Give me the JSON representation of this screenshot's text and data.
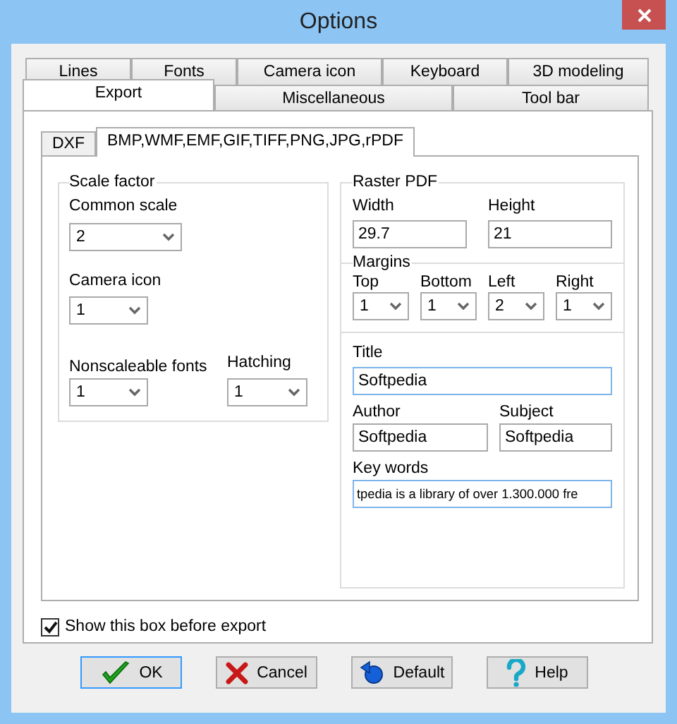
{
  "window": {
    "title": "Options"
  },
  "tab_rows": [
    [
      {
        "label": "Lines",
        "selected": false
      },
      {
        "label": "Fonts",
        "selected": false
      },
      {
        "label": "Camera icon",
        "selected": false
      },
      {
        "label": "Keyboard",
        "selected": false
      },
      {
        "label": "3D modeling",
        "selected": false
      }
    ],
    [
      {
        "label": "Export",
        "selected": true
      },
      {
        "label": "Miscellaneous",
        "selected": false
      },
      {
        "label": "Tool bar",
        "selected": false
      }
    ]
  ],
  "subtabs": [
    {
      "label": "DXF",
      "selected": false
    },
    {
      "label": "BMP,WMF,EMF,GIF,TIFF,PNG,JPG,rPDF",
      "selected": true
    }
  ],
  "scale_factor": {
    "title": "Scale factor",
    "common_scale": {
      "label": "Common scale",
      "value": "2"
    },
    "camera_icon": {
      "label": "Camera icon",
      "value": "1"
    },
    "nonscaleable_fonts": {
      "label": "Nonscaleable fonts",
      "value": "1"
    },
    "hatching": {
      "label": "Hatching",
      "value": "1"
    }
  },
  "raster_pdf": {
    "title": "Raster PDF",
    "size": [
      {
        "label": "Width",
        "value": "29.7",
        "focused": false
      },
      {
        "label": "Height",
        "value": "21",
        "focused": false
      }
    ],
    "margins": {
      "title": "Margins",
      "items": [
        {
          "label": "Top",
          "value": "1"
        },
        {
          "label": "Bottom",
          "value": "1"
        },
        {
          "label": "Left",
          "value": "2"
        },
        {
          "label": "Right",
          "value": "1"
        }
      ]
    },
    "title_field": {
      "label": "Title",
      "value": "Softpedia",
      "focused": true
    },
    "author": {
      "label": "Author",
      "value": "Softpedia",
      "focused": false
    },
    "subject": {
      "label": "Subject",
      "value": "Softpedia",
      "focused": false
    },
    "key_words": {
      "label": "Key words",
      "value": "tpedia is a library of over 1.300.000 fre",
      "focused": true
    }
  },
  "show_before_export": {
    "label": "Show this box before export",
    "checked": true
  },
  "buttons": [
    {
      "kind": "ok",
      "label": "OK",
      "default": true
    },
    {
      "kind": "cancel",
      "label": "Cancel",
      "default": false
    },
    {
      "kind": "reset",
      "label": "Default",
      "default": false
    },
    {
      "kind": "help",
      "label": "Help",
      "default": false
    }
  ]
}
